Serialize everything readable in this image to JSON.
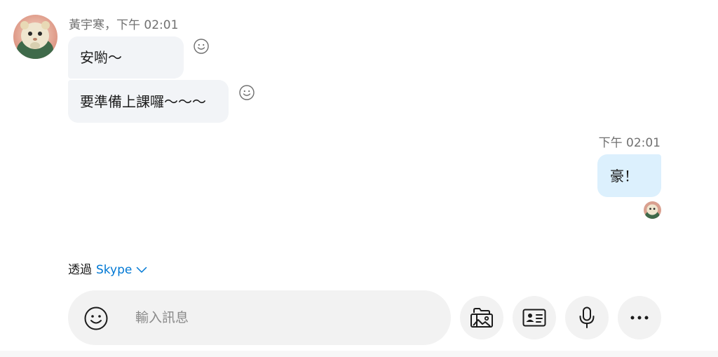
{
  "conversation": {
    "incoming": {
      "sender_name": "黃宇寒",
      "separator": "，",
      "time": "下午 02:01",
      "messages": [
        "安喲～",
        "要準備上課囉～～～"
      ]
    },
    "outgoing": {
      "time": "下午 02:01",
      "messages": [
        "豪！"
      ]
    }
  },
  "footer": {
    "via_prefix": "透過",
    "via_service": "Skype"
  },
  "composer": {
    "placeholder": "輸入訊息"
  },
  "icons": {
    "reaction": "smiley-react-icon",
    "emoji": "emoji-icon",
    "media": "image-gallery-icon",
    "contact": "contact-card-icon",
    "mic": "microphone-icon",
    "more": "more-options-icon",
    "chevron": "chevron-down-icon"
  },
  "colors": {
    "incoming_bubble": "#f2f4f7",
    "outgoing_bubble": "#dcf0fd",
    "accent": "#0078d4"
  }
}
